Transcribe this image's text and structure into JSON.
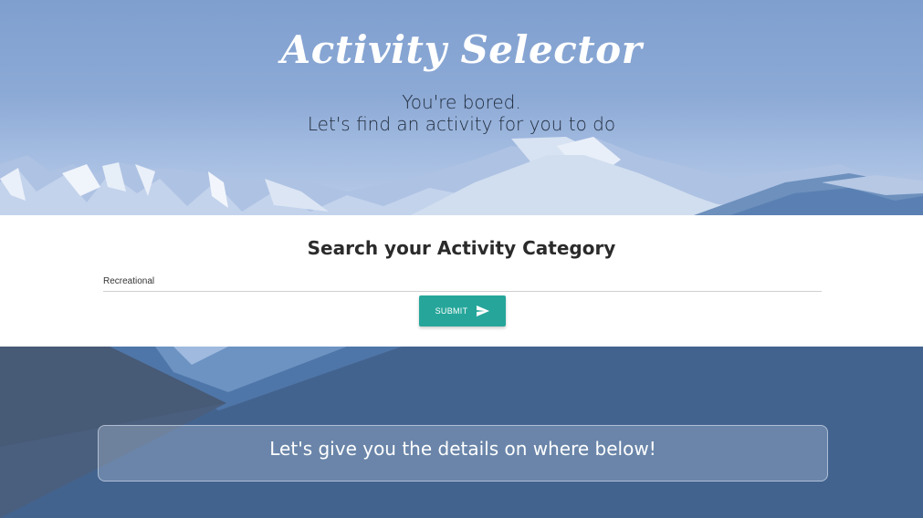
{
  "hero": {
    "title": "Activity Selector",
    "subtitle_line1": "You're bored.",
    "subtitle_line2": "Let's find an activity for you to do"
  },
  "search": {
    "heading": "Search your Activity Category",
    "input_value": "Recreational",
    "submit_label": "SUBMIT",
    "submit_icon": "send-icon"
  },
  "details": {
    "text": "Let's give you the details on where below!"
  },
  "colors": {
    "accent": "#26a69a",
    "hero_sky": "#8daad6",
    "bottom_bg": "#43638f",
    "panel_bg": "#ffffff"
  }
}
